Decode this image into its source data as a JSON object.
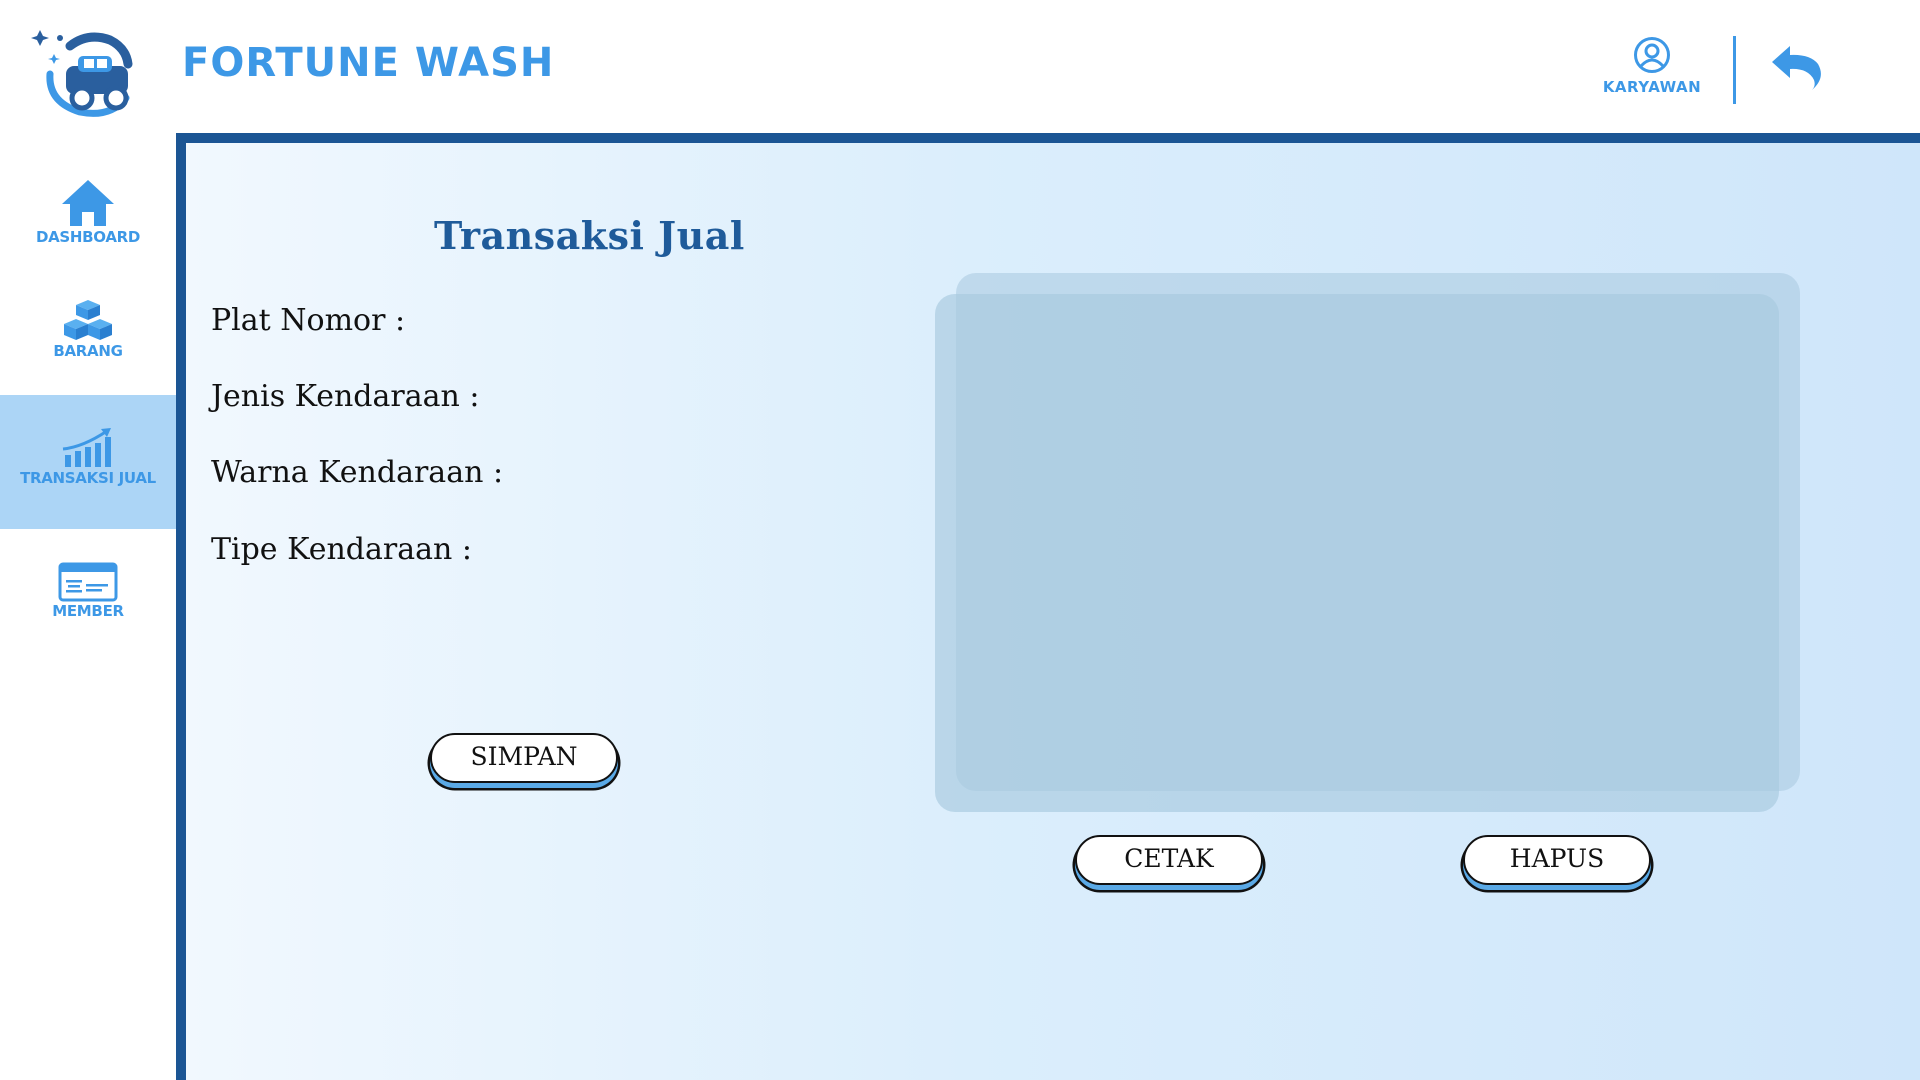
{
  "header": {
    "brand": "FORTUNE WASH",
    "user_label": "KARYAWAN",
    "icons": {
      "logo": "car-wash-logo",
      "user": "user-circle-icon",
      "back": "undo-arrow-icon"
    }
  },
  "sidebar": {
    "items": [
      {
        "label": "DASHBOARD",
        "icon": "home-icon",
        "active": false
      },
      {
        "label": "BARANG",
        "icon": "boxes-icon",
        "active": false
      },
      {
        "label": "TRANSAKSI JUAL",
        "icon": "growth-chart-icon",
        "active": true
      },
      {
        "label": "MEMBER",
        "icon": "member-card-icon",
        "active": false
      }
    ]
  },
  "main": {
    "title": "Transaksi  Jual",
    "fields": [
      {
        "label": "Plat Nomor :"
      },
      {
        "label": "Jenis Kendaraan :"
      },
      {
        "label": "Warna Kendaraan :"
      },
      {
        "label": "Tipe Kendaraan :"
      }
    ],
    "buttons": {
      "save": "SIMPAN",
      "print": "CETAK",
      "delete": "HAPUS"
    }
  },
  "colors": {
    "accent": "#3d98e6",
    "frame": "#1b5594",
    "title": "#1f5b9a",
    "active_bg": "#acd5f6",
    "preview": "#a7c9de"
  }
}
